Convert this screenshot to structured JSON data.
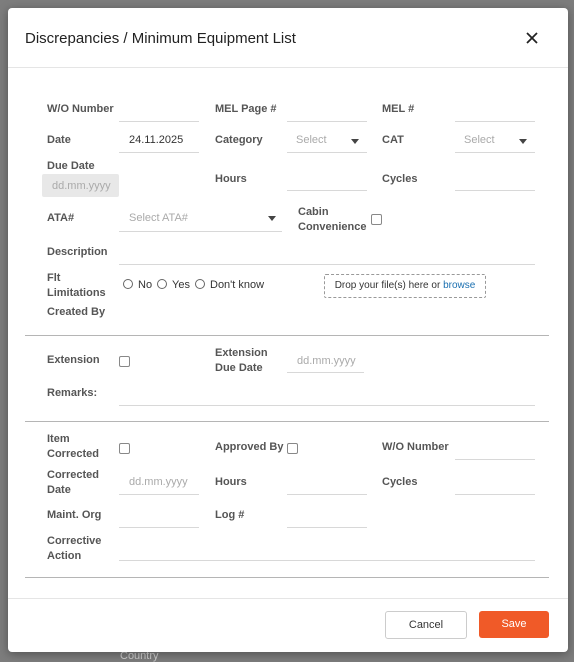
{
  "background": {
    "hint": "Country"
  },
  "modal": {
    "title": "Discrepancies / Minimum Equipment List",
    "fields": {
      "wo_number_label": "W/O Number",
      "mel_page_label": "MEL Page #",
      "mel_label": "MEL #",
      "date_label": "Date",
      "date_value": "24.11.2025",
      "category_label": "Category",
      "category_value": "Select",
      "cat_label": "CAT",
      "cat_value": "Select",
      "due_date_label": "Due Date",
      "due_date_placeholder": "dd.mm.yyyy",
      "hours_label": "Hours",
      "cycles_label": "Cycles",
      "ata_label": "ATA#",
      "ata_placeholder": "Select ATA#",
      "cabin_label_1": "Cabin",
      "cabin_label_2": "Convenience",
      "description_label": "Description",
      "flt_label_1": "Flt",
      "flt_label_2": "Limitations",
      "radio_no": "No",
      "radio_yes": "Yes",
      "radio_dont_know": "Don't know",
      "dropzone_text": "Drop your file(s) here or",
      "dropzone_link": "browse",
      "created_by_label": "Created By"
    },
    "extension": {
      "extension_label": "Extension",
      "ext_due_label_1": "Extension",
      "ext_due_label_2": "Due Date",
      "ext_due_placeholder": "dd.mm.yyyy",
      "remarks_label": "Remarks:"
    },
    "correction": {
      "item_label_1": "Item",
      "item_label_2": "Corrected",
      "approved_by_label": "Approved By",
      "wo_number_label": "W/O Number",
      "corrected_date_label_1": "Corrected",
      "corrected_date_label_2": "Date",
      "corrected_date_placeholder": "dd.mm.yyyy",
      "hours_label": "Hours",
      "cycles_label": "Cycles",
      "maint_org_label": "Maint. Org",
      "log_label": "Log #",
      "corrective_label_1": "Corrective",
      "corrective_label_2": "Action"
    },
    "footer": {
      "cancel_label": "Cancel",
      "save_label": "Save"
    }
  },
  "colors": {
    "accent": "#f05a28",
    "link": "#1a6fb0",
    "overlay": "#7d7d7d"
  },
  "icons": [
    "close-icon",
    "chevron-down-icon"
  ]
}
